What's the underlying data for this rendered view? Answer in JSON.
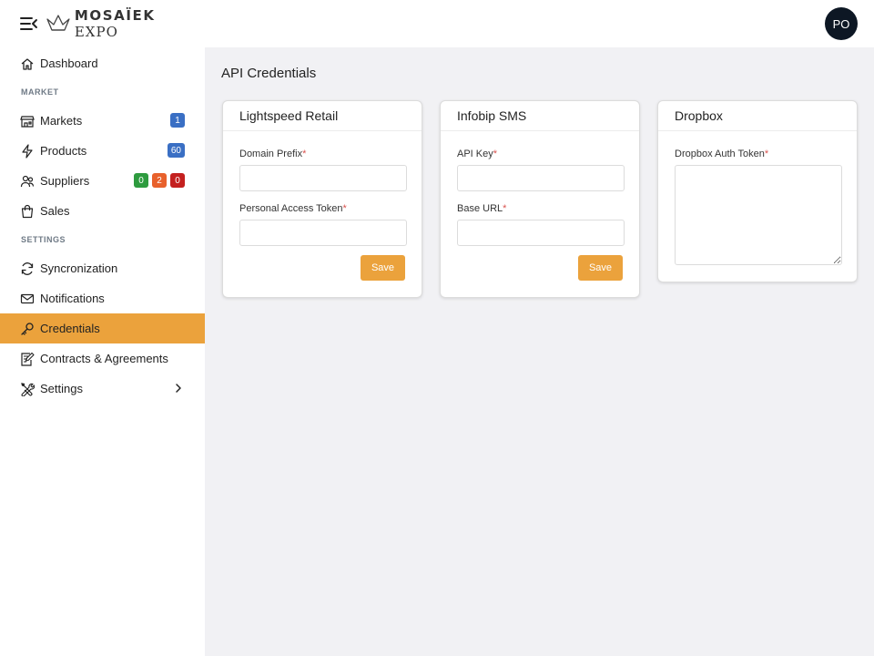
{
  "brand": {
    "name": "MOSAÏEK",
    "sub": "EXPO"
  },
  "user": {
    "initials": "PO"
  },
  "sidebar": {
    "dashboard": "Dashboard",
    "section_market": "MARKET",
    "markets": {
      "label": "Markets",
      "badge": "1"
    },
    "products": {
      "label": "Products",
      "badge": "60"
    },
    "suppliers": {
      "label": "Suppliers",
      "badges": [
        "0",
        "2",
        "0"
      ]
    },
    "sales": "Sales",
    "section_settings": "SETTINGS",
    "syncronization": "Syncronization",
    "notifications": "Notifications",
    "credentials": "Credentials",
    "contracts": "Contracts & Agreements",
    "settings": "Settings"
  },
  "colors": {
    "accent": "#eba23c",
    "badge_blue": "#3a6fc4",
    "badge_green": "#2e9b3f",
    "badge_orange": "#e8612c",
    "badge_red": "#c4201f"
  },
  "page": {
    "title": "API Credentials"
  },
  "cards": {
    "lightspeed": {
      "title": "Lightspeed Retail",
      "field1_label": "Domain Prefix",
      "field1_value": "",
      "field2_label": "Personal Access Token",
      "field2_value": "",
      "save": "Save"
    },
    "infobip": {
      "title": "Infobip SMS",
      "field1_label": "API Key",
      "field1_value": "",
      "field2_label": "Base URL",
      "field2_value": "",
      "save": "Save"
    },
    "dropbox": {
      "title": "Dropbox",
      "field1_label": "Dropbox Auth Token",
      "field1_value": ""
    }
  },
  "required_mark": "*"
}
